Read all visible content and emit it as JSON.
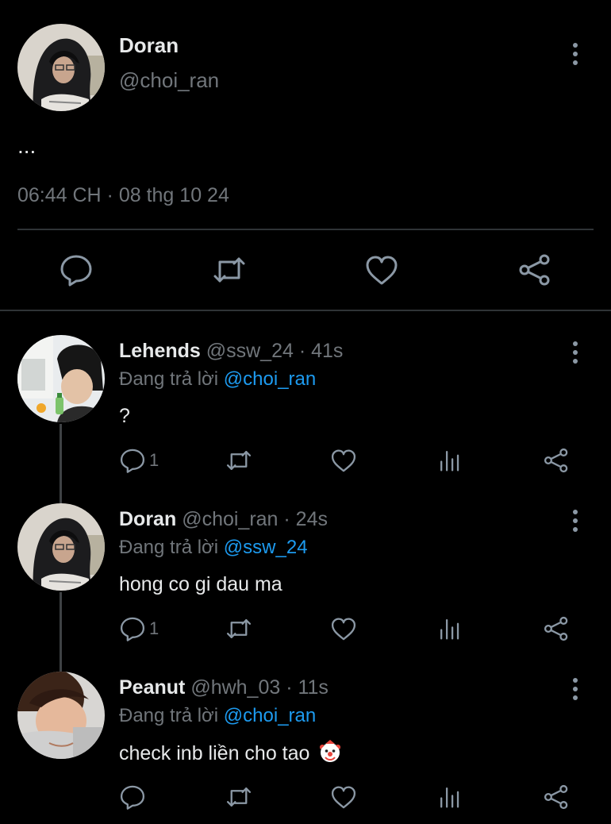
{
  "main_tweet": {
    "name": "Doran",
    "handle": "@choi_ran",
    "text": "...",
    "timestamp": "06:44 CH · 08 thg 10 24",
    "actions": [
      "reply-icon",
      "retweet-icon",
      "like-icon",
      "share-icon"
    ]
  },
  "replies": [
    {
      "name": "Lehends",
      "meta": "@ssw_24 · 41s",
      "replying_prefix": "Đang trả lời",
      "replying_to": "@choi_ran",
      "text": "?",
      "reply_count": "1"
    },
    {
      "name": "Doran",
      "meta": "@choi_ran · 24s",
      "replying_prefix": "Đang trả lời",
      "replying_to": "@ssw_24",
      "text": "hong co gi dau ma",
      "reply_count": "1"
    },
    {
      "name": "Peanut",
      "meta": "@hwh_03 · 11s",
      "replying_prefix": "Đang trả lời",
      "replying_to": "@choi_ran",
      "text": "check inb liền cho tao",
      "emoji": "clown-face-icon",
      "reply_count": ""
    }
  ],
  "colors": {
    "background": "#000000",
    "text": "#e7e9ea",
    "secondary": "#71767b",
    "link": "#1d9bf0",
    "divider": "#2f3336",
    "icon": "#8b98a5"
  }
}
